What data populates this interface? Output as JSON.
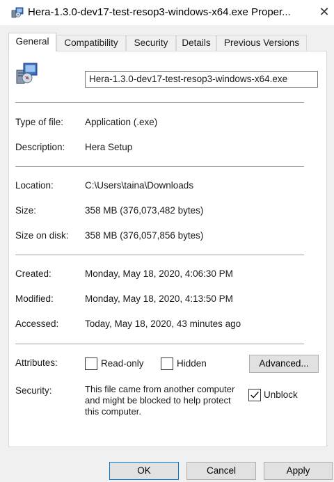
{
  "window": {
    "title": "Hera-1.3.0-dev17-test-resop3-windows-x64.exe Proper...",
    "close_symbol": "✕",
    "icon": "installer-icon"
  },
  "tabs": [
    {
      "label": "General"
    },
    {
      "label": "Compatibility"
    },
    {
      "label": "Security"
    },
    {
      "label": "Details"
    },
    {
      "label": "Previous Versions"
    }
  ],
  "general": {
    "filename": "Hera-1.3.0-dev17-test-resop3-windows-x64.exe",
    "type_label": "Type of file:",
    "type_value": "Application (.exe)",
    "description_label": "Description:",
    "description_value": "Hera Setup",
    "location_label": "Location:",
    "location_value": "C:\\Users\\taina\\Downloads",
    "size_label": "Size:",
    "size_value": "358 MB (376,073,482 bytes)",
    "size_on_disk_label": "Size on disk:",
    "size_on_disk_value": "358 MB (376,057,856 bytes)",
    "created_label": "Created:",
    "created_value": "Monday, May 18, 2020, 4:06:30 PM",
    "modified_label": "Modified:",
    "modified_value": "Monday, May 18, 2020, 4:13:50 PM",
    "accessed_label": "Accessed:",
    "accessed_value": "Today, May 18, 2020, 43 minutes ago",
    "attributes_label": "Attributes:",
    "readonly_label": "Read-only",
    "hidden_label": "Hidden",
    "advanced_label": "Advanced...",
    "security_label": "Security:",
    "security_text": "This file came from another computer and might be blocked to help protect this computer.",
    "unblock_label": "Unblock",
    "readonly_checked": false,
    "hidden_checked": false,
    "unblock_checked": true
  },
  "buttons": {
    "ok": "OK",
    "cancel": "Cancel",
    "apply": "Apply"
  }
}
